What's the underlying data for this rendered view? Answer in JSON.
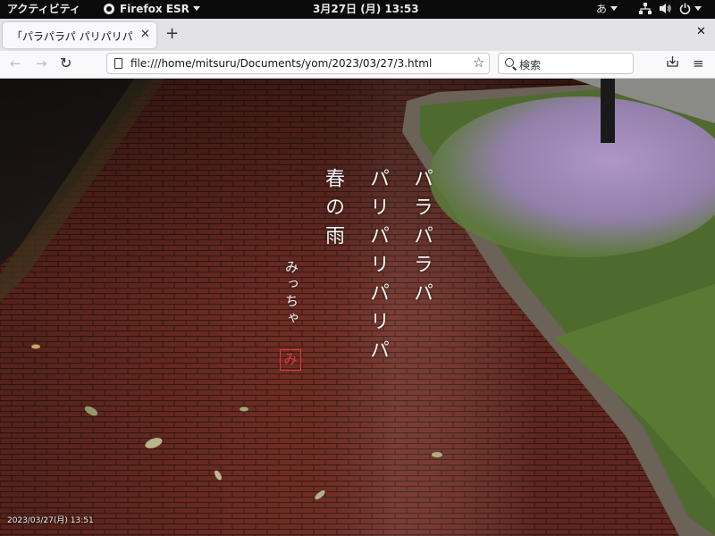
{
  "topbar": {
    "activities": "アクティビティ",
    "app_name": "Firefox ESR",
    "clock": "3月27日 (月)  13:53",
    "input_method": "あ",
    "icons": [
      "network-icon",
      "volume-icon",
      "power-icon"
    ]
  },
  "browser": {
    "tab_title": "「パラパラパ パリパリパリパ」",
    "new_tab_symbol": "+",
    "url": "file:///home/mitsuru/Documents/yom/2023/03/27/3.html",
    "search_placeholder": "検索"
  },
  "page": {
    "poem_lines": [
      "パラパラパ",
      "パリパリパリパ",
      "春の雨"
    ],
    "author": "みっちゃ",
    "seal_char": "み",
    "timestamp": "2023/03/27(月) 13:51"
  },
  "colors": {
    "topbar_bg": "#0b0b0b",
    "seal_red": "#e03a3a",
    "brick": "#6b2c22"
  }
}
